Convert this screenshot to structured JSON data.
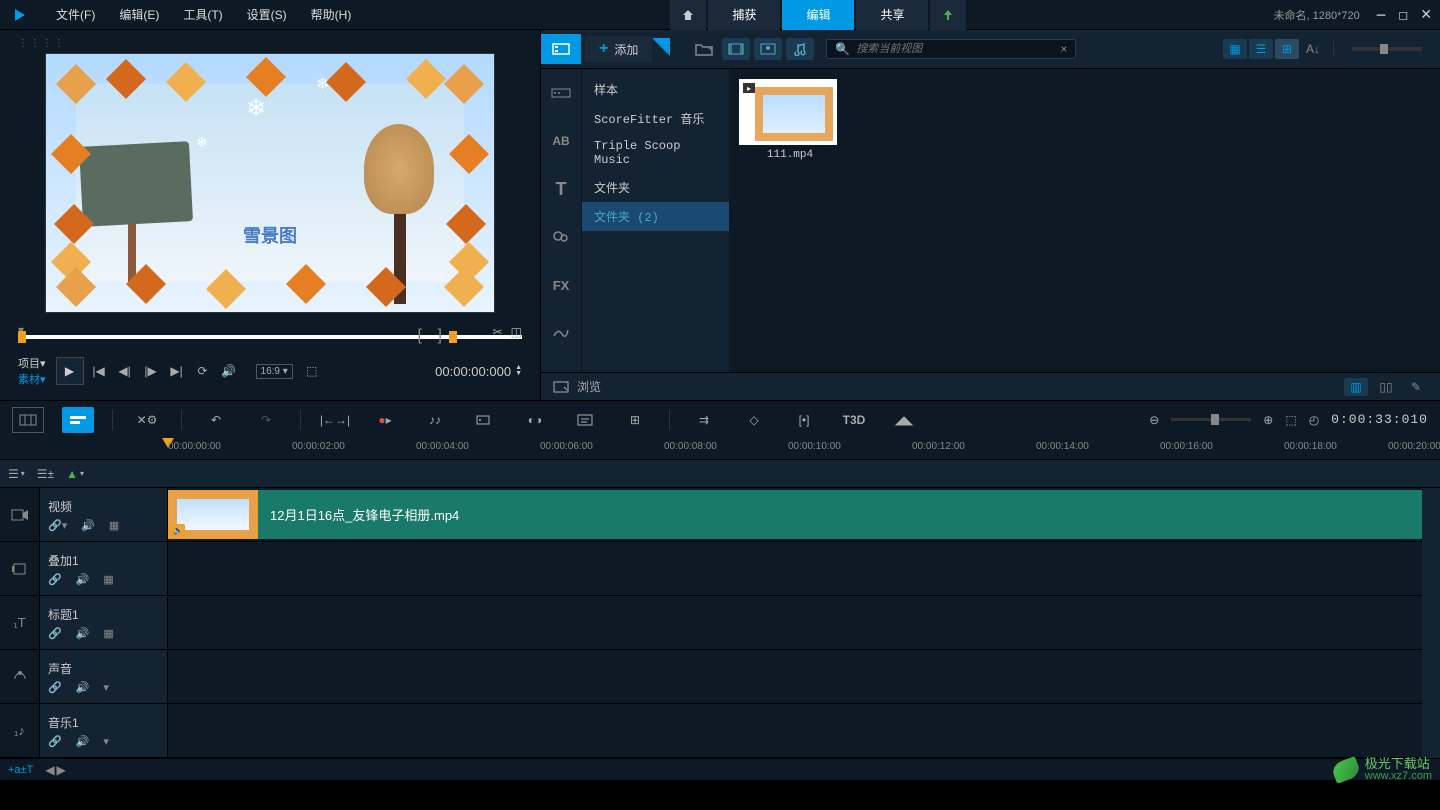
{
  "menubar": {
    "items": [
      "文件(F)",
      "编辑(E)",
      "工具(T)",
      "设置(S)",
      "帮助(H)"
    ],
    "tabs": {
      "capture": "捕获",
      "edit": "编辑",
      "share": "共享"
    },
    "project_info": "未命名, 1280*720"
  },
  "preview": {
    "caption": "雪景图",
    "labels": {
      "project": "项目",
      "clip": "素材"
    },
    "aspect": "16:9",
    "timecode": "00:00:00:000"
  },
  "library": {
    "add_label": "添加",
    "search_placeholder": "搜索当前视图",
    "sidebar": {
      "ab": "AB",
      "t": "T",
      "fx": "FX"
    },
    "tree": [
      "样本",
      "ScoreFitter 音乐",
      "Triple Scoop Music",
      "文件夹",
      "文件夹 (2)"
    ],
    "tree_selected_index": 4,
    "thumb": {
      "name": "111.mp4"
    },
    "footer_browse": "浏览"
  },
  "timeline": {
    "timecode": "0:00:33:010",
    "t3d_label": "T3D",
    "ruler_ticks": [
      "00:00:00:00",
      "00:00:02:00",
      "00:00:04:00",
      "00:00:06:00",
      "00:00:08:00",
      "00:00:10:00",
      "00:00:12:00",
      "00:00:14:00",
      "00:00:16:00",
      "00:00:18:00",
      "00:00:20:00"
    ],
    "tracks": {
      "video": "视频",
      "overlay": "叠加1",
      "title": "标题1",
      "voice": "声音",
      "music": "音乐1"
    },
    "clip_name": "12月1日16点_友锋电子相册.mp4"
  },
  "bottom": {
    "add_track": "+a±T",
    "watermark_name": "极光下载站",
    "watermark_site": "www.xz7.com"
  }
}
